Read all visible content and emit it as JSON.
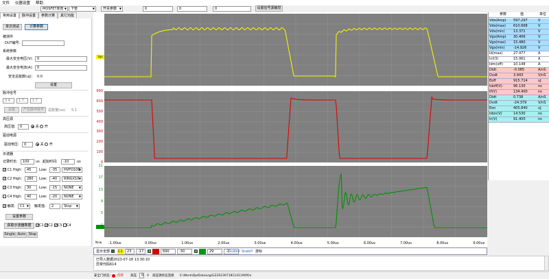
{
  "menu": [
    "文件",
    "仪器设置",
    "帮助"
  ],
  "toolbar": {
    "device": "MOSFET单管",
    "position": "下管",
    "switch_param": "开关参数",
    "value1": "0",
    "value2": "0",
    "value3": "0",
    "set_param_button": "设置信号源触觉"
  },
  "tabs": [
    "常用设置",
    "脉冲设置",
    "参数计算",
    "其它功能"
  ],
  "left": {
    "single_test": "单次测试",
    "calc_param": "计算参数",
    "dut_section": "被测件",
    "dut_id_label": "DUT编号:",
    "sys_section": "系统参数",
    "max_voltage_label": "最大安全电压(V):",
    "max_voltage": "0",
    "max_current_label": "最大安全电流(A):",
    "max_current": "0",
    "safe_energy_label": "安全总能数(uJ):",
    "safe_energy": "0.0",
    "set_button": "设置",
    "pulse_section": "脉冲信号",
    "pulse_vals": [
      "3.4",
      "1.7",
      "1.7"
    ],
    "pulse_set_button": "设置",
    "pulse_gen_button": "产生脉冲信号",
    "total_time_label": "总脉宽(us):",
    "total_time": "5.1",
    "hv_section": "高压源",
    "hv_label": "高压值:",
    "hv_value": "0",
    "off_label": "关",
    "on_label": "开",
    "drive_section": "驱动电源",
    "drive_label": "驱动电压:",
    "drive_value": "0",
    "scope_section": "示波器",
    "record_label": "记录时长:",
    "record_value": "100",
    "record_unit": "us",
    "start_label": "起始时间:",
    "start_value": "-10",
    "start_unit": "us",
    "channels": [
      {
        "name": "C1",
        "high_label": "High:",
        "high": "45",
        "low_label": "Low:",
        "low": "-35",
        "probe": "HVFO108",
        "checked": true
      },
      {
        "name": "C2",
        "high_label": "High:",
        "high": "280",
        "low_label": "Low:",
        "low": "-40",
        "probe": "RINGX10",
        "checked": true
      },
      {
        "name": "C3",
        "high_label": "High:",
        "high": "30",
        "low_label": "Low:",
        "low": "-15",
        "probe": "NONE",
        "checked": true
      },
      {
        "name": "C4",
        "high_label": "High:",
        "high": "40",
        "low_label": "Low:",
        "low": "-20",
        "probe": "NONE",
        "checked": false
      }
    ],
    "trigger_label": "触发:",
    "trigger_ch": "C1",
    "trigger_val_label": "触发值:",
    "trigger_val": "2",
    "trigger_mode": "Stop",
    "set_params_button": "设置参数",
    "get_waveform_button": "获取示波器数据",
    "wave_ch": [
      "C1",
      "C2",
      "C3",
      "C4"
    ],
    "single_button": "Single",
    "auto_button": "Auto",
    "stop_button": "Stop"
  },
  "scope": {
    "plot1_label": "Vgs",
    "plot2_ticks": [
      "690",
      "600",
      "500",
      "400",
      "300",
      "200",
      "100",
      "0"
    ],
    "plot3_ticks": [
      "21",
      "17",
      "13",
      "9",
      "5",
      "1"
    ],
    "x_prefix": "Nsw",
    "x_ticks": [
      "-1.00us",
      "0.00us",
      "1.00us",
      "2.00us",
      "3.00us",
      "4.00us",
      "5.00us",
      "6.00us",
      "7.00us",
      "8.00us",
      "9.00us"
    ],
    "colors": {
      "ch1": "#f5f500",
      "ch2": "#e00000",
      "ch3": "#009000"
    }
  },
  "params": {
    "headers": [
      "参数",
      "值",
      "单位"
    ],
    "rows": [
      {
        "name": "Vds(Amp)",
        "value": "597.297",
        "unit": "V",
        "color": "#a6dfff"
      },
      {
        "name": "Vds(max)",
        "value": "610.668",
        "unit": "V",
        "color": "#a6dfff"
      },
      {
        "name": "Vds(min)",
        "value": "13.371",
        "unit": "V",
        "color": "#a6dfff"
      },
      {
        "name": "Vgs(Amp)",
        "value": "30.406",
        "unit": "V",
        "color": "#a6dfff"
      },
      {
        "name": "Vgs(max)",
        "value": "15.480",
        "unit": "V",
        "color": "#a6dfff"
      },
      {
        "name": "Vgs(min)",
        "value": "-14.926",
        "unit": "V",
        "color": "#a6dfff"
      },
      {
        "name": "Id(max)",
        "value": "27.477",
        "unit": "A",
        "color": "#ffffff"
      },
      {
        "name": "Ic(t3)",
        "value": "15.061",
        "unit": "A",
        "color": "#ffffff"
      },
      {
        "name": "Idm(off)",
        "value": "10.148",
        "unit": "A",
        "color": "#ffffff"
      },
      {
        "name": "Didt",
        "value": "-0.085",
        "unit": "A/nS",
        "color": "#ffc8c8"
      },
      {
        "name": "Dvdt",
        "value": "3.943",
        "unit": "V/nS",
        "color": "#ffc8c8"
      },
      {
        "name": "Eoff",
        "value": "915.714",
        "unit": "uJ",
        "color": "#ffc8c8"
      },
      {
        "name": "tdoff(V)",
        "value": "96.130",
        "unit": "ns",
        "color": "#ffc8c8"
      },
      {
        "name": "tf(V)",
        "value": "134.400",
        "unit": "ns",
        "color": "#ffc8c8"
      },
      {
        "name": "Didt",
        "value": "0.738",
        "unit": "A/nS",
        "color": "#a6f0f0"
      },
      {
        "name": "Dvdt",
        "value": "-24.379",
        "unit": "V/nS",
        "color": "#a6f0f0"
      },
      {
        "name": "Eon",
        "value": "405.840",
        "unit": "uJ",
        "color": "#a6f0f0"
      },
      {
        "name": "tdon(V)",
        "value": "14.530",
        "unit": "ns",
        "color": "#a6f0f0"
      },
      {
        "name": "tr(V)",
        "value": "91.400",
        "unit": "ns",
        "color": "#a6f0f0"
      }
    ]
  },
  "bottom": {
    "show_all": "显示全部",
    "c1_label": "C1",
    "c1_a": "23",
    "c1_b": "-17",
    "c2_a": "690",
    "c2_b": "-30",
    "c3_a": "29",
    "c3_b": "-1",
    "scale_x": "ScaleX",
    "scale_y": "ScaleY",
    "cursor": "游标"
  },
  "log": {
    "line1": "已导入数据2023-07-18 13:30:10",
    "line2": "异常代码614"
  },
  "status": {
    "safety_label": "安全门状态:",
    "safety_state": "打开",
    "hv_label": "高压",
    "hv_value": "0",
    "hv_unit": "V",
    "path_label": "高压源状态连接",
    "path": "E:\\Work\\DptDataLog\\G2202307181141190fOn"
  }
}
